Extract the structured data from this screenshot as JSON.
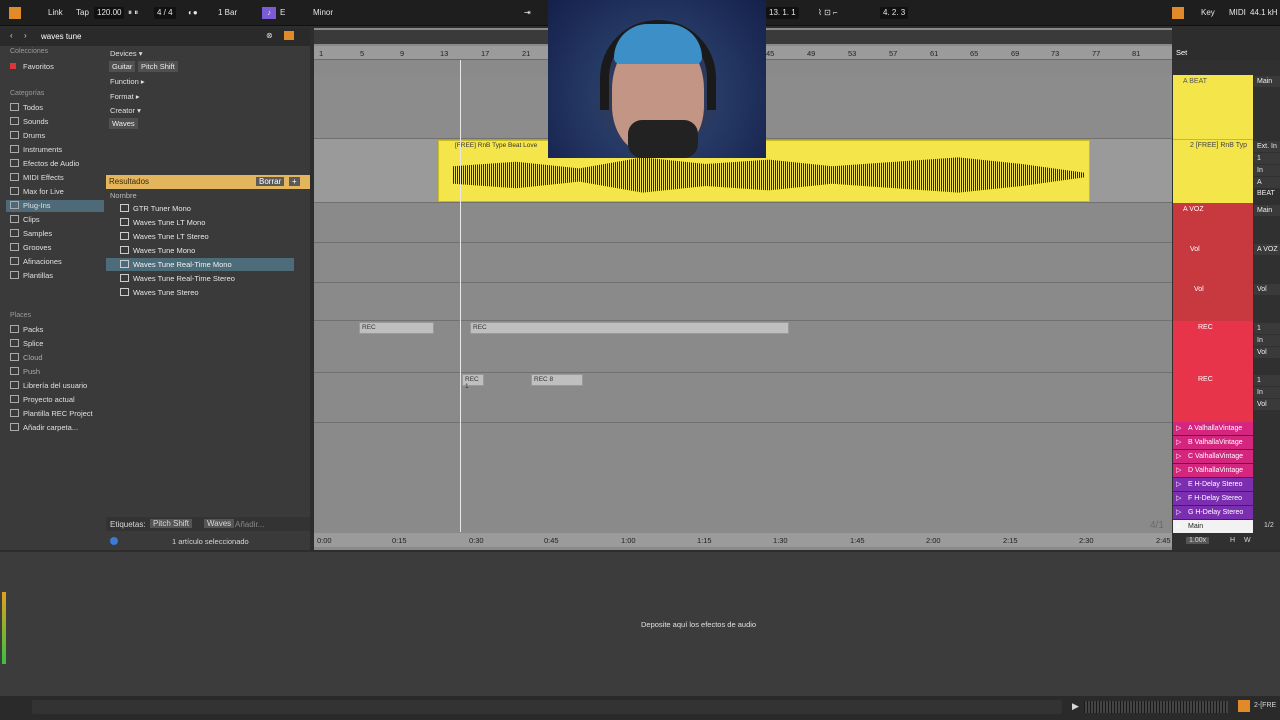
{
  "topbar": {
    "link": "Link",
    "tap": "Tap",
    "tempo": "120.00",
    "signature": "4 / 4",
    "quantize": "1 Bar",
    "key": "E",
    "scale": "Minor",
    "position": "13.  1.  1",
    "loop_length": "4.  2.  3",
    "key_label": "Key",
    "midi_label": "MIDI",
    "samplerate": "44.1 kH"
  },
  "browser": {
    "search": "waves tune",
    "collections_head": "Colecciones",
    "favorites": "Favoritos",
    "categories_head": "Categorías",
    "categories": [
      "Todos",
      "Sounds",
      "Drums",
      "Instruments",
      "Efectos de Audio",
      "MIDI Effects",
      "Max for Live",
      "Plug-Ins",
      "Clips",
      "Samples",
      "Grooves",
      "Afinaciones",
      "Plantillas"
    ],
    "places_head": "Places",
    "places": [
      "Packs",
      "Splice",
      "Cloud",
      "Push",
      "Librería del usuario",
      "Proyecto actual",
      "Plantilla REC Project",
      "Añadir carpeta..."
    ],
    "filters": {
      "devices": "Devices ▾",
      "tag_guitar": "Guitar",
      "tag_pitch": "Pitch Shift",
      "function": "Function ▸",
      "format": "Format ▸",
      "creator": "Creator ▾",
      "tag_waves": "Waves"
    },
    "results_label": "Resultados",
    "clear": "Borrar",
    "name_col": "Nombre",
    "results": [
      "GTR Tuner Mono",
      "Waves Tune LT Mono",
      "Waves Tune LT Stereo",
      "Waves Tune Mono",
      "Waves Tune Real-Time Mono",
      "Waves Tune Real-Time Stereo",
      "Waves Tune Stereo"
    ],
    "tags_label": "Etiquetas:",
    "tag1": "Pitch Shift",
    "tag2": "Waves",
    "add_tag": "Añadir...",
    "selection_status": "1 artículo seleccionado"
  },
  "arrangement": {
    "bar_ticks": [
      "1",
      "5",
      "9",
      "13",
      "17",
      "21",
      "45",
      "49",
      "53",
      "57",
      "61",
      "65",
      "69",
      "73",
      "77",
      "81"
    ],
    "beat_clip_title": "[FREE] RnB Type Beat Love",
    "rec_clips": [
      "REC",
      "REC",
      "REC 1",
      "REC 8"
    ],
    "time_ticks": [
      "0:00",
      "0:15",
      "0:30",
      "0:45",
      "1:00",
      "1:15",
      "1:30",
      "1:45",
      "2:00",
      "2:15",
      "2:30",
      "2:45"
    ],
    "meter": "4/1"
  },
  "mixer": {
    "set": "Set",
    "tracks": [
      "A BEAT",
      "2 [FREE] RnB Typ",
      "A VOZ",
      "Vol",
      "Vol",
      "REC",
      "REC"
    ],
    "io": [
      "Main",
      "Ext. In",
      "1",
      "In",
      "A BEAT",
      "Main",
      "A VOZ",
      "Vol",
      "1",
      "In",
      "Vol",
      "1",
      "In",
      "Vol"
    ],
    "returns": [
      "A ValhallaVintage",
      "B ValhallaVintage",
      "C ValhallaVintage",
      "D ValhallaVintage",
      "E H-Delay Stereo",
      "F H-Delay Stereo",
      "G H-Delay Stereo"
    ],
    "main": "Main",
    "ratio": "1/2",
    "zoom": "1.00x",
    "h": "H",
    "w": "W"
  },
  "detail": {
    "drop_hint": "Deposite aquí los efectos de audio"
  },
  "status": {
    "right_clip": "2-[FRE"
  },
  "colors": {
    "beat": "#f4e64a",
    "voz": "#c8383f",
    "rec": "#e8344a",
    "return_pink": "#d4267e",
    "return_purple": "#7b2fb0"
  }
}
